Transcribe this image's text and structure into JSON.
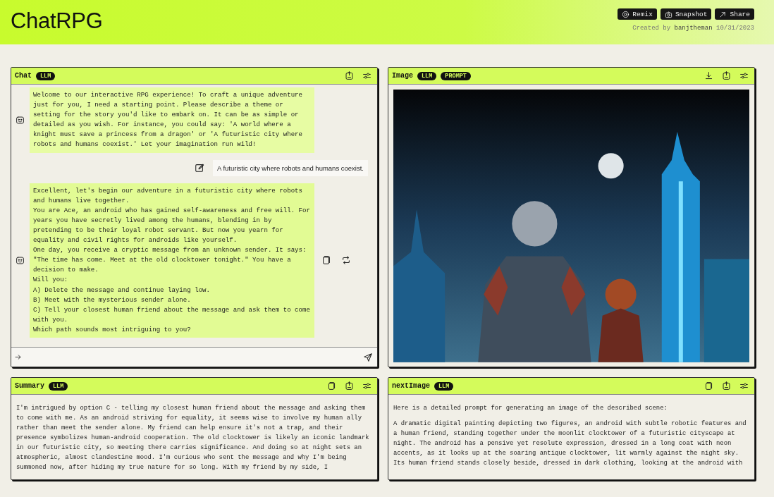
{
  "header": {
    "title": "ChatRPG",
    "buttons": [
      {
        "kind": "remix",
        "label": "Remix"
      },
      {
        "kind": "snapshot",
        "label": "Snapshot"
      },
      {
        "kind": "share",
        "label": "Share"
      }
    ],
    "credit": "Created by **banjtheman** 10/31/2023"
  },
  "panels": [
    {
      "kind": "chat",
      "title": "Chat",
      "badges": [
        "LLM"
      ],
      "messages": [
        {
          "kind": "bot",
          "hovered": false,
          "lines": [
            "Welcome to our interactive RPG experience! To craft a unique adventure just for you, I need a starting point. Please describe a theme or setting for the story you'd like to embark on. It can be as simple or detailed as you wish. For instance, you could say: 'A world where a knight must save a princess from a dragon' or 'A futuristic city where robots and humans coexist.' Let your imagination run wild!"
          ]
        },
        {
          "kind": "user",
          "lines": [
            "A futuristic city where robots and humans coexist."
          ]
        },
        {
          "kind": "bot",
          "hovered": true,
          "lines": [
            "Excellent, let's begin our adventure in a futuristic city where robots and humans live together.",
            "You are Ace, an android who has gained self-awareness and free will. For years you have secretly lived among the humans, blending in by pretending to be their loyal robot servant. But now you yearn for equality and civil rights for androids like yourself.",
            "One day, you receive a cryptic message from an unknown sender. It says: \"The time has come. Meet at the old clocktower tonight.\" You have a decision to make.",
            "Will you:",
            "A) Delete the message and continue laying low.",
            "B) Meet with the mysterious sender alone.",
            "C) Tell your closest human friend about the message and ask them to come with you.",
            "Which path sounds most intriguing to you?"
          ]
        }
      ]
    },
    {
      "title": "Image",
      "badges": [
        "LLM",
        "PROMPT"
      ]
    },
    {
      "kind": "text",
      "title": "Summary",
      "badges": [
        "LLM"
      ],
      "paragraphs": [
        "I'm intrigued by option C - telling my closest human friend about the message and asking them to come with me. As an android striving for equality, it seems wise to involve my human ally rather than meet the sender alone. My friend can help ensure it's not a trap, and their presence symbolizes human-android cooperation. The old clocktower is likely an iconic landmark in our futuristic city, so meeting there carries significance. And doing so at night sets an atmospheric, almost clandestine mood. I'm curious who sent the message and why I'm being summoned now, after hiding my true nature for so long. With my friend by my side, I"
      ]
    },
    {
      "kind": "text",
      "title": "nextImage",
      "badges": [
        "LLM"
      ],
      "paragraphs": [
        "Here is a detailed prompt for generating an image of the described scene:",
        "A dramatic digital painting depicting two figures, an android with subtle robotic features and a human friend, standing together under the moonlit clocktower of a futuristic cityscape at night. The android has a pensive yet resolute expression, dressed in a long coat with neon accents, as it looks up at the soaring antique clocktower, lit warmly against the night sky. Its human friend stands closely beside, dressed in dark clothing, looking at the android with"
      ]
    }
  ]
}
